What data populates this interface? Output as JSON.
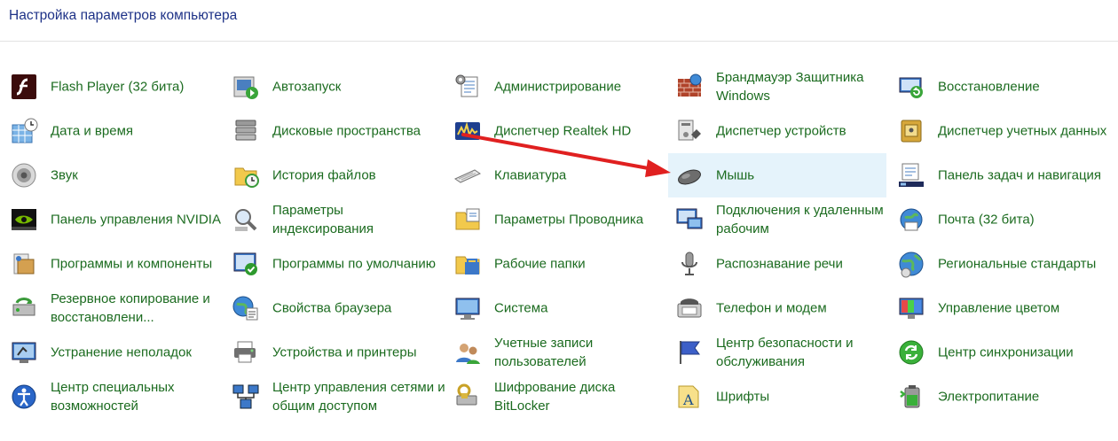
{
  "header": {
    "title": "Настройка параметров компьютера"
  },
  "columns": [
    {
      "items": [
        {
          "label": "Flash Player (32 бита)",
          "icon": "flash-player-icon"
        },
        {
          "label": "Дата и время",
          "icon": "date-time-icon"
        },
        {
          "label": "Звук",
          "icon": "sound-icon"
        },
        {
          "label": "Панель управления NVIDIA",
          "icon": "nvidia-icon"
        },
        {
          "label": "Программы и компоненты",
          "icon": "programs-icon"
        },
        {
          "label": "Резервное копирование и восстановлени...",
          "icon": "backup-icon"
        },
        {
          "label": "Устранение неполадок",
          "icon": "troubleshooting-icon"
        },
        {
          "label": "Центр специальных возможностей",
          "icon": "accessibility-icon"
        }
      ]
    },
    {
      "items": [
        {
          "label": "Автозапуск",
          "icon": "autoplay-icon"
        },
        {
          "label": "Дисковые пространства",
          "icon": "storage-spaces-icon"
        },
        {
          "label": "История файлов",
          "icon": "file-history-icon"
        },
        {
          "label": "Параметры индексирования",
          "icon": "indexing-icon"
        },
        {
          "label": "Программы по умолчанию",
          "icon": "default-programs-icon"
        },
        {
          "label": "Свойства браузера",
          "icon": "internet-options-icon"
        },
        {
          "label": "Устройства и принтеры",
          "icon": "printers-icon"
        },
        {
          "label": "Центр управления сетями и общим доступом",
          "icon": "network-center-icon"
        }
      ]
    },
    {
      "items": [
        {
          "label": "Администрирование",
          "icon": "admin-tools-icon"
        },
        {
          "label": "Диспетчер Realtek HD",
          "icon": "realtek-icon"
        },
        {
          "label": "Клавиатура",
          "icon": "keyboard-icon"
        },
        {
          "label": "Параметры Проводника",
          "icon": "explorer-options-icon"
        },
        {
          "label": "Рабочие папки",
          "icon": "work-folders-icon"
        },
        {
          "label": "Система",
          "icon": "system-icon"
        },
        {
          "label": "Учетные записи пользователей",
          "icon": "user-accounts-icon"
        },
        {
          "label": "Шифрование диска BitLocker",
          "icon": "bitlocker-icon"
        }
      ]
    },
    {
      "items": [
        {
          "label": "Брандмауэр Защитника Windows",
          "icon": "firewall-icon"
        },
        {
          "label": "Диспетчер устройств",
          "icon": "device-manager-icon"
        },
        {
          "label": "Мышь",
          "icon": "mouse-icon",
          "hover": true
        },
        {
          "label": "Подключения к удаленным рабочим",
          "icon": "remote-desktop-icon"
        },
        {
          "label": "Распознавание речи",
          "icon": "speech-icon"
        },
        {
          "label": "Телефон и модем",
          "icon": "phone-modem-icon"
        },
        {
          "label": "Центр безопасности и обслуживания",
          "icon": "security-center-icon"
        },
        {
          "label": "Шрифты",
          "icon": "fonts-icon"
        }
      ]
    },
    {
      "items": [
        {
          "label": "Восстановление",
          "icon": "recovery-icon"
        },
        {
          "label": "Диспетчер учетных данных",
          "icon": "credential-manager-icon"
        },
        {
          "label": "Панель задач и навигация",
          "icon": "taskbar-icon"
        },
        {
          "label": "Почта (32 бита)",
          "icon": "mail-icon"
        },
        {
          "label": "Региональные стандарты",
          "icon": "region-icon"
        },
        {
          "label": "Управление цветом",
          "icon": "color-management-icon"
        },
        {
          "label": "Центр синхронизации",
          "icon": "sync-center-icon"
        },
        {
          "label": "Электропитание",
          "icon": "power-options-icon"
        }
      ]
    }
  ],
  "annotation": {
    "arrow_color": "#e02020"
  },
  "colors": {
    "link": "#1b6b1f",
    "title": "#1e3287",
    "hover": "#e5f3fb"
  }
}
